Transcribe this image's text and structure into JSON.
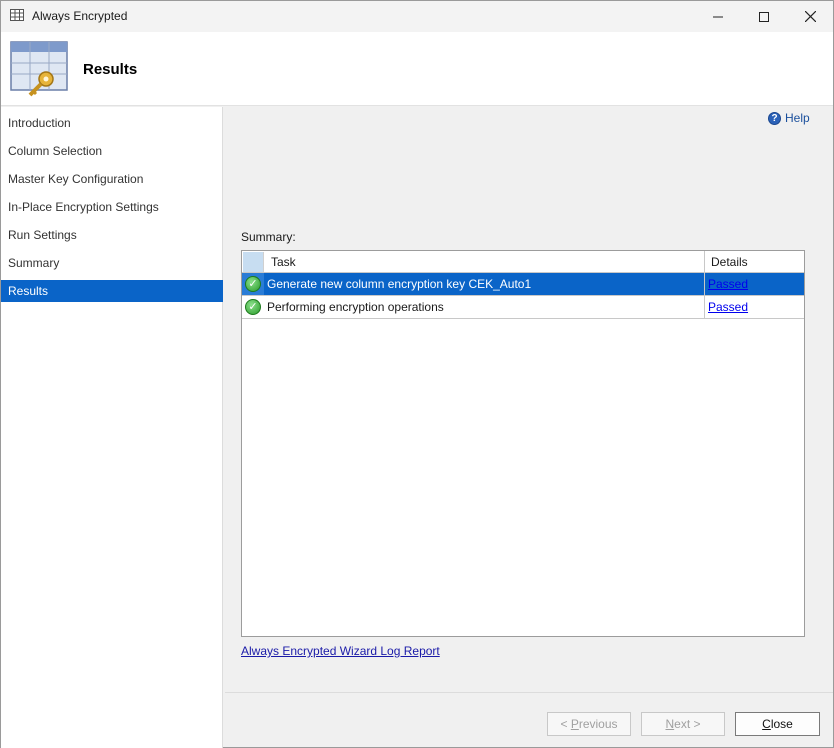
{
  "window": {
    "title": "Always Encrypted"
  },
  "banner": {
    "title": "Results"
  },
  "nav": {
    "items": [
      {
        "label": "Introduction"
      },
      {
        "label": "Column Selection"
      },
      {
        "label": "Master Key Configuration"
      },
      {
        "label": "In-Place Encryption Settings"
      },
      {
        "label": "Run Settings"
      },
      {
        "label": "Summary"
      },
      {
        "label": "Results",
        "selected": true
      }
    ]
  },
  "content": {
    "help_label": "Help",
    "summary_label": "Summary:",
    "table": {
      "columns": [
        "Task",
        "Details"
      ],
      "rows": [
        {
          "task": "Generate new column encryption key CEK_Auto1",
          "details": "Passed",
          "status": "success"
        },
        {
          "task": "Performing encryption operations",
          "details": "Passed",
          "status": "success"
        }
      ]
    },
    "log_link": "Always Encrypted Wizard Log Report"
  },
  "footer": {
    "prev_prefix": "< ",
    "prev_accel": "P",
    "prev_rest": "revious",
    "next_accel": "N",
    "next_rest": "ext >",
    "close_accel": "C",
    "close_rest": "lose"
  },
  "icons": {
    "app": "table-key-icon",
    "banner": "table-key-icon",
    "help": "help-icon",
    "status": "check-circle-icon"
  },
  "colors": {
    "selection": "#0a64c8",
    "link": "#0000ee",
    "success": "#2a9b2a"
  }
}
